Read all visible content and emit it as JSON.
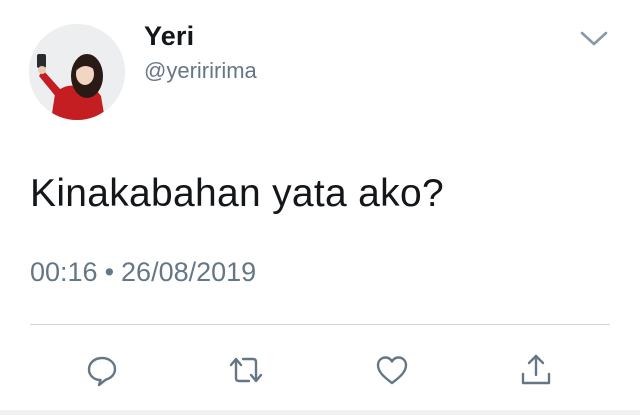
{
  "author": {
    "display_name": "Yeri",
    "handle": "@yeriririma"
  },
  "tweet": {
    "text": "Kinakabahan yata ako?",
    "time": "00:16",
    "separator": "•",
    "date": "26/08/2019"
  },
  "actions": [
    {
      "icon": "reply-icon"
    },
    {
      "icon": "retweet-icon"
    },
    {
      "icon": "like-icon"
    },
    {
      "icon": "share-icon"
    }
  ],
  "colors": {
    "text": "#14171a",
    "secondary": "#657786",
    "icon": "#657786",
    "divider": "#cfd5da"
  }
}
